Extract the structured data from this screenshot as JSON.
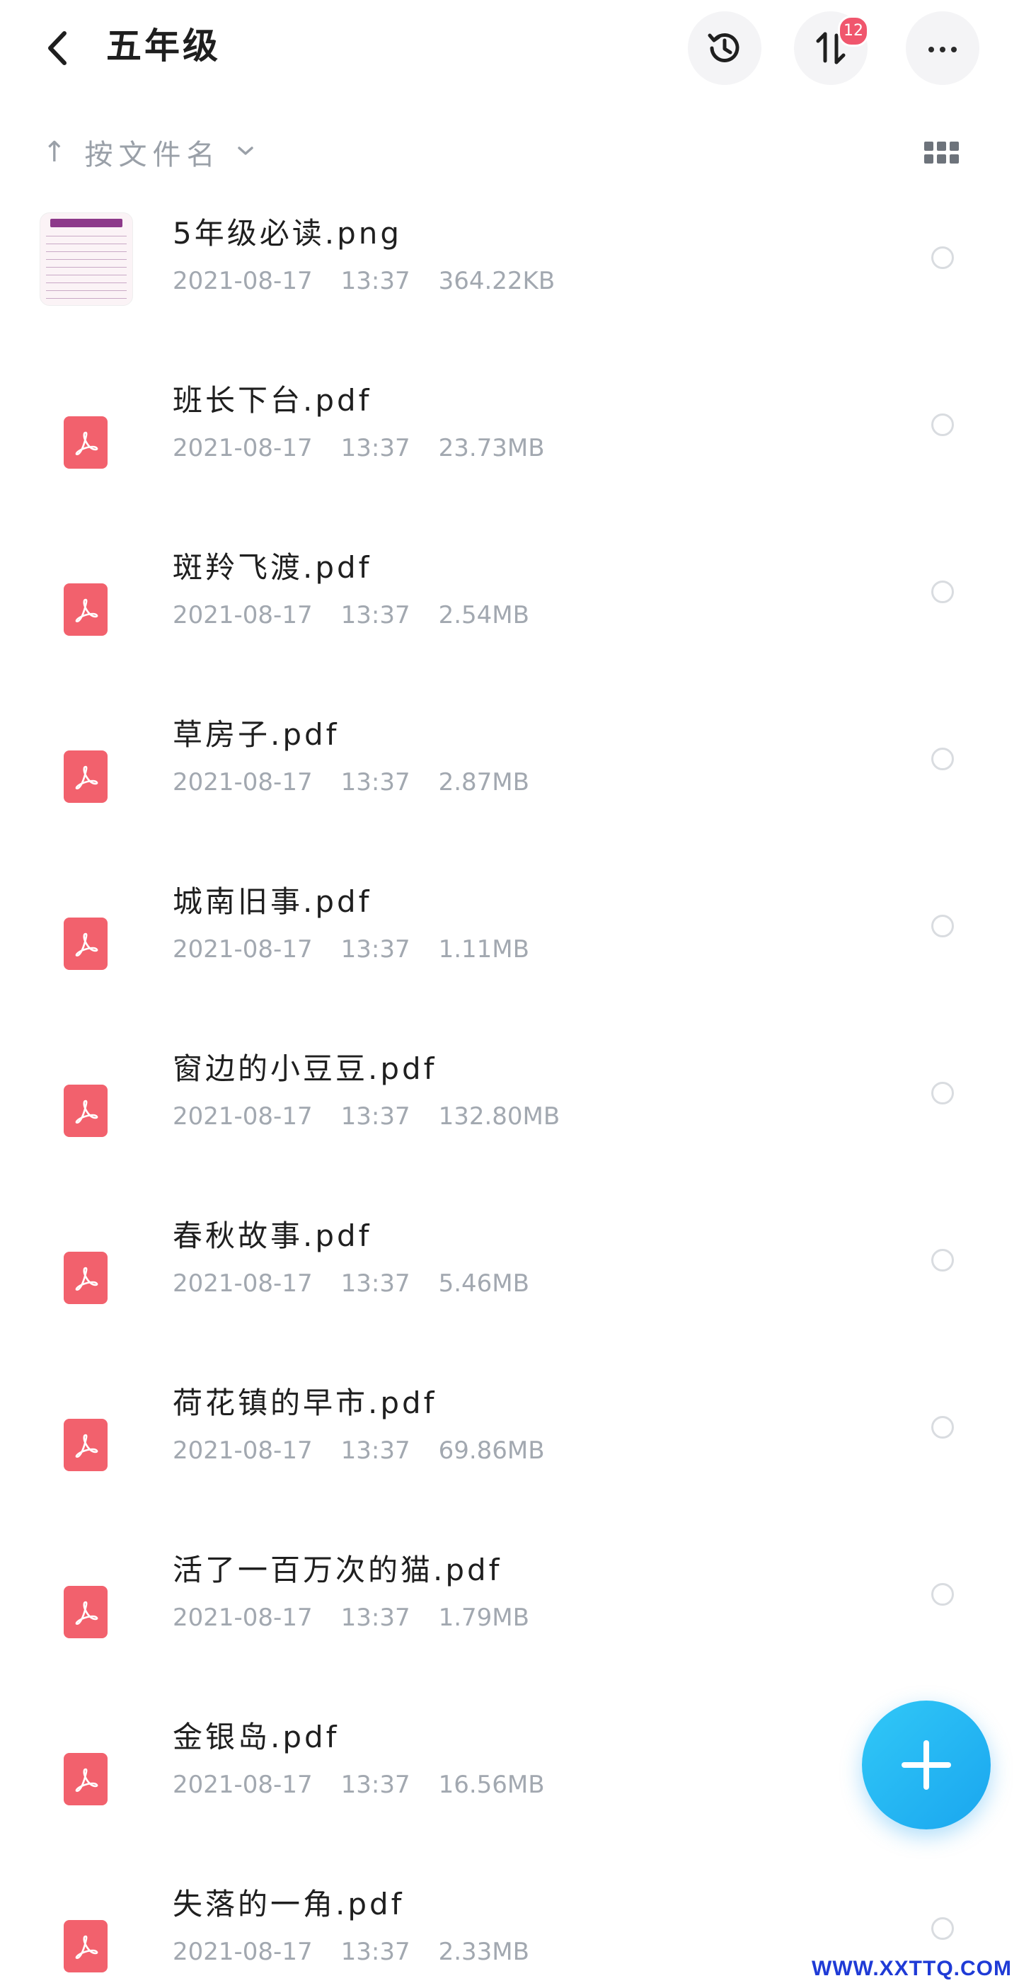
{
  "header": {
    "title": "五年级",
    "transfer_badge": "12"
  },
  "sort": {
    "arrow": "↑",
    "label": "按文件名"
  },
  "files": [
    {
      "name": "5年级必读.png",
      "date": "2021-08-17",
      "time": "13:37",
      "size": "364.22KB",
      "type": "image"
    },
    {
      "name": "班长下台.pdf",
      "date": "2021-08-17",
      "time": "13:37",
      "size": "23.73MB",
      "type": "pdf"
    },
    {
      "name": "斑羚飞渡.pdf",
      "date": "2021-08-17",
      "time": "13:37",
      "size": "2.54MB",
      "type": "pdf"
    },
    {
      "name": "草房子.pdf",
      "date": "2021-08-17",
      "time": "13:37",
      "size": "2.87MB",
      "type": "pdf"
    },
    {
      "name": "城南旧事.pdf",
      "date": "2021-08-17",
      "time": "13:37",
      "size": "1.11MB",
      "type": "pdf"
    },
    {
      "name": "窗边的小豆豆.pdf",
      "date": "2021-08-17",
      "time": "13:37",
      "size": "132.80MB",
      "type": "pdf"
    },
    {
      "name": "春秋故事.pdf",
      "date": "2021-08-17",
      "time": "13:37",
      "size": "5.46MB",
      "type": "pdf"
    },
    {
      "name": "荷花镇的早市.pdf",
      "date": "2021-08-17",
      "time": "13:37",
      "size": "69.86MB",
      "type": "pdf"
    },
    {
      "name": "活了一百万次的猫.pdf",
      "date": "2021-08-17",
      "time": "13:37",
      "size": "1.79MB",
      "type": "pdf"
    },
    {
      "name": "金银岛.pdf",
      "date": "2021-08-17",
      "time": "13:37",
      "size": "16.56MB",
      "type": "pdf"
    },
    {
      "name": "失落的一角.pdf",
      "date": "2021-08-17",
      "time": "13:37",
      "size": "2.33MB",
      "type": "pdf"
    }
  ],
  "watermark": "WWW.XXTTQ.COM",
  "colors": {
    "pdf_icon": "#f2616d",
    "fab": "#1aa6ef",
    "badge": "#f0566d"
  }
}
